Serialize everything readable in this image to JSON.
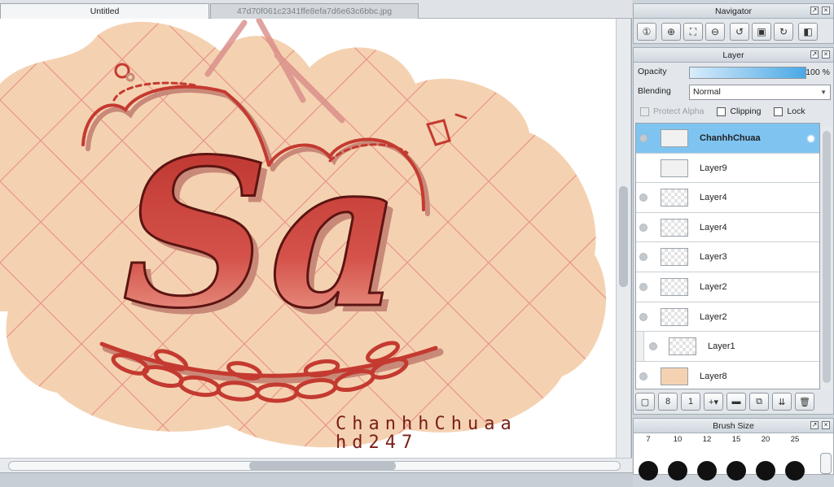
{
  "document_tabs": [
    {
      "label": "Untitled",
      "active": true
    },
    {
      "label": "47d70f061c2341ffe8efa7d6e63c6bbc.jpg",
      "active": false
    }
  ],
  "artwork": {
    "big_text": "Sa",
    "signature_line1": "ChanhhChuaa",
    "signature_line2": "hd247",
    "colors": {
      "background_blob": "#f4d2b1",
      "grid_lines": "#e8867d",
      "letters": "#c43a30",
      "shadow": "#c98979"
    }
  },
  "navigator": {
    "title": "Navigator",
    "tools": [
      "zoom-actual-icon",
      "zoom-in-icon",
      "fit-window-icon",
      "zoom-out-icon",
      "rotate-left-icon",
      "reset-rotation-icon",
      "rotate-right-icon",
      "flip-icon"
    ]
  },
  "layer_panel": {
    "title": "Layer",
    "opacity_label": "Opacity",
    "opacity_value": "100 %",
    "opacity_fraction": 1.0,
    "blending_label": "Blending",
    "blending_value": "Normal",
    "protect_alpha_label": "Protect Alpha",
    "clipping_label": "Clipping",
    "lock_label": "Lock",
    "layers": [
      {
        "name": "ChanhhChuaa",
        "selected": true,
        "thumb": "solid"
      },
      {
        "name": "Layer9",
        "selected": false,
        "thumb": "solid"
      },
      {
        "name": "Layer4",
        "selected": false,
        "thumb": "checker"
      },
      {
        "name": "Layer4",
        "selected": false,
        "thumb": "checker"
      },
      {
        "name": "Layer3",
        "selected": false,
        "thumb": "checker"
      },
      {
        "name": "Layer2",
        "selected": false,
        "thumb": "checker"
      },
      {
        "name": "Layer2",
        "selected": false,
        "thumb": "checker"
      },
      {
        "name": "Layer1",
        "selected": false,
        "thumb": "checker",
        "clipped": true
      },
      {
        "name": "Layer8",
        "selected": false,
        "thumb": "peach"
      }
    ],
    "tools": [
      "new-layer-icon",
      "new-layer-8bit-icon",
      "new-layer-1bit-icon",
      "add-special-layer-icon",
      "new-folder-icon",
      "copy-layer-icon",
      "merge-down-icon",
      "delete-layer-icon"
    ]
  },
  "brush_panel": {
    "title": "Brush Size",
    "sizes": [
      "7",
      "10",
      "12",
      "15",
      "20",
      "25"
    ]
  }
}
